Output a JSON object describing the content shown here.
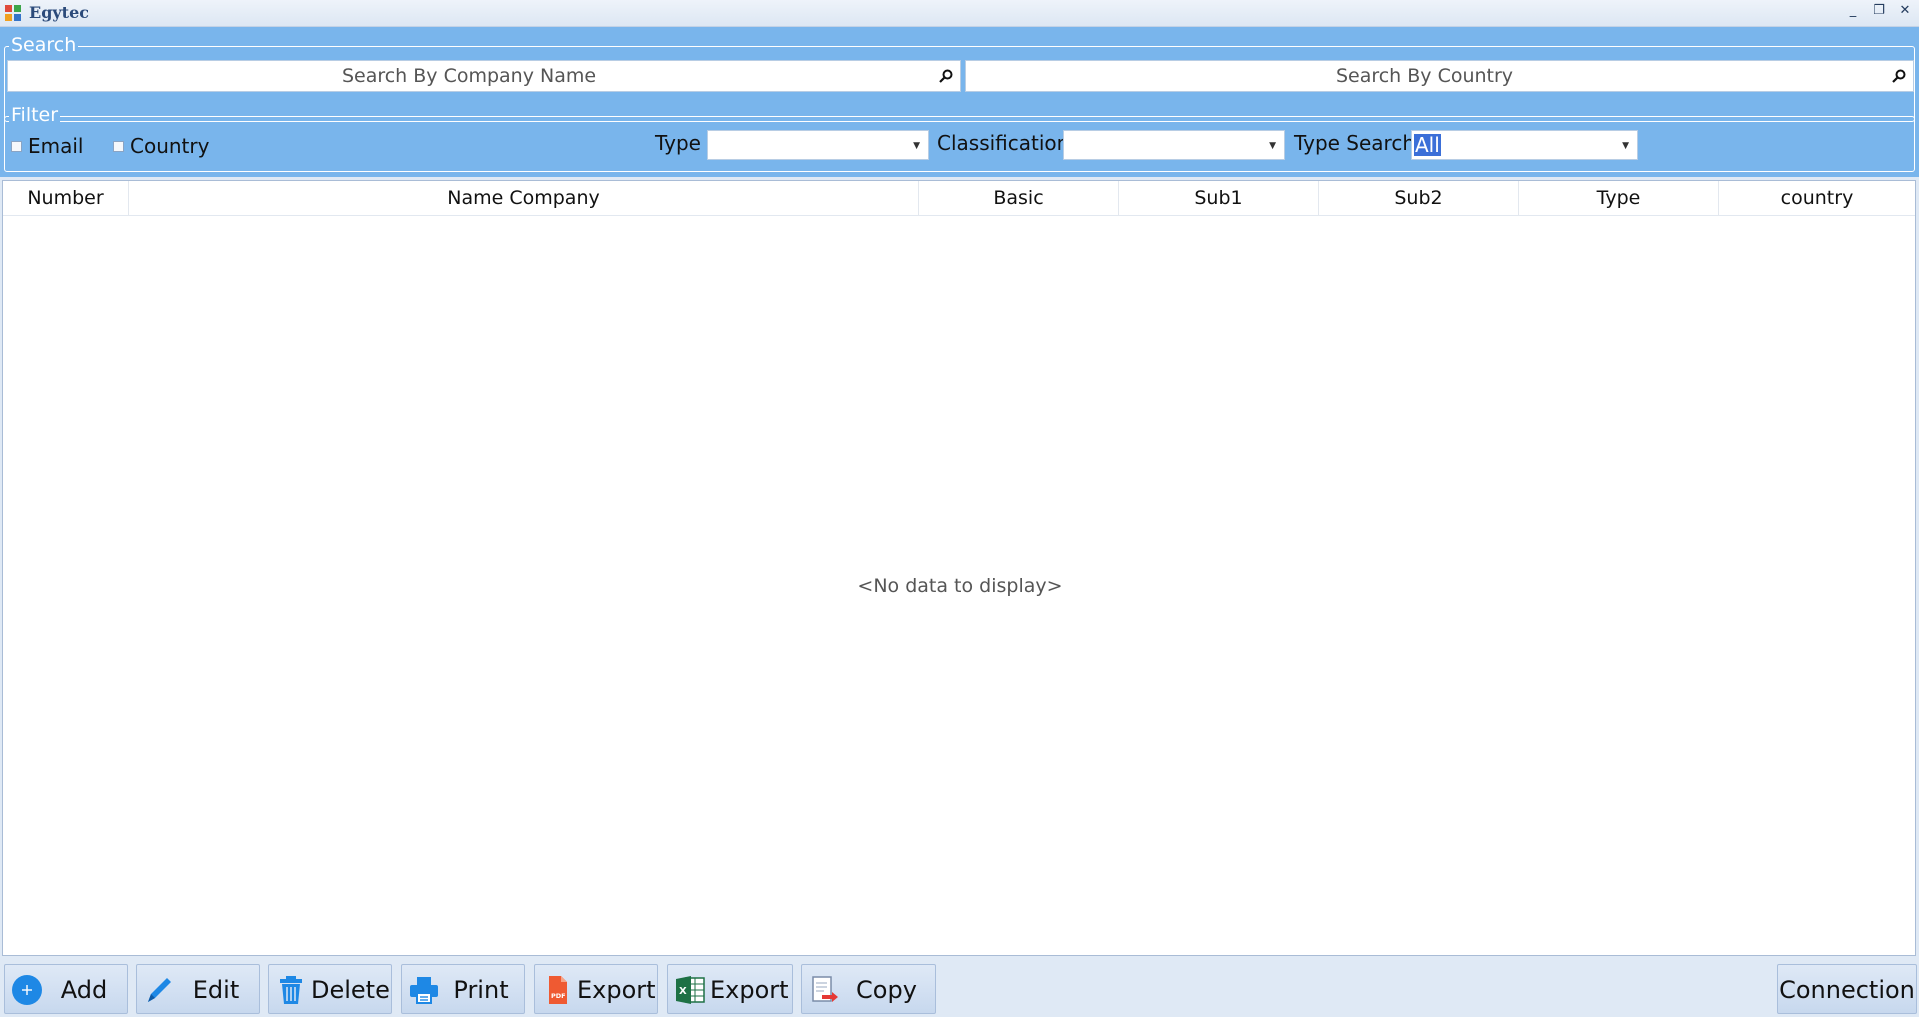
{
  "window": {
    "title": "Egytec",
    "controls": [
      "_",
      "❐",
      "✕"
    ]
  },
  "search": {
    "legend": "Search",
    "company_placeholder": "Search By Company Name",
    "country_placeholder": "Search By Country"
  },
  "filter": {
    "legend": "Filter",
    "email_label": "Email",
    "country_label": "Country",
    "type_label": "Type",
    "type_value": "",
    "classification_label": "Classification",
    "classification_value": "",
    "type_search_label": "Type Search",
    "type_search_value": "All"
  },
  "grid": {
    "columns": [
      "Number",
      "Name Company",
      "Basic",
      "Sub1",
      "Sub2",
      "Type",
      "country"
    ],
    "rows": [],
    "empty_text": "<No data to display>"
  },
  "toolbar": {
    "add": "Add",
    "edit": "Edit",
    "delete": "Delete",
    "print": "Print",
    "export_pdf": "Export",
    "export_excel": "Export",
    "copy": "Copy",
    "connection": "Connection"
  },
  "icons": {
    "app": "app-logo-icon",
    "add": "plus-circle-icon",
    "edit": "pencil-icon",
    "delete": "trash-icon",
    "print": "printer-icon",
    "export_pdf": "pdf-icon",
    "export_excel": "excel-icon",
    "copy": "copy-document-icon"
  },
  "colors": {
    "panel": "#79b5ec",
    "selection": "#3b6fd8",
    "window_bg": "#dfe9f5"
  }
}
